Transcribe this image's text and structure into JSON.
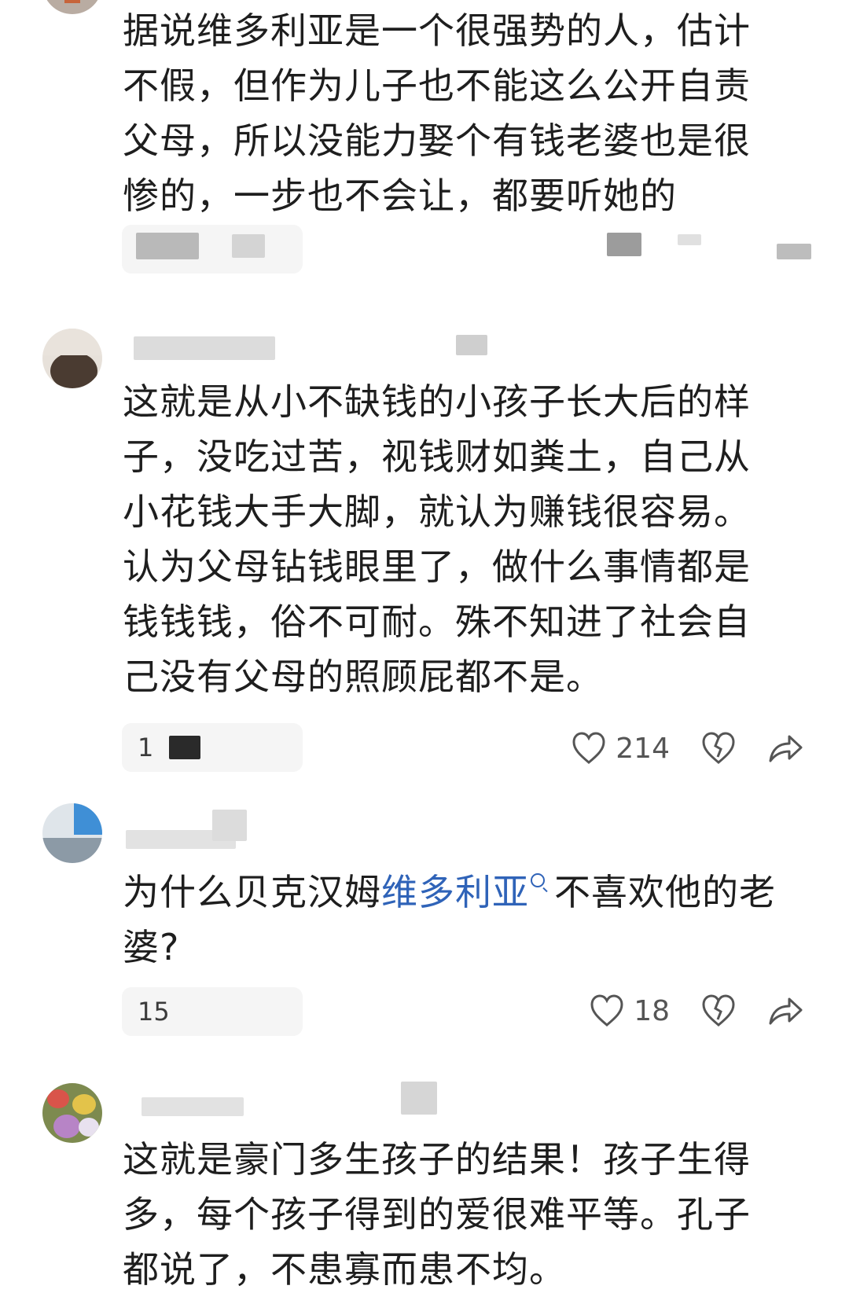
{
  "comments": [
    {
      "text": "据说维多利亚是一个很强势的人，估计不假，但作为儿子也不能这么公开自责父母，所以没能力娶个有钱老婆也是很惨的，一步也不会让，都要听她的"
    },
    {
      "text": "这就是从小不缺钱的小孩子长大后的样子，没吃过苦，视钱财如粪土，自己从小花钱大手大脚，就认为赚钱很容易。认为父母钻钱眼里了，做什么事情都是钱钱钱，俗不可耐。殊不知进了社会自己没有父母的照顾屁都不是。",
      "reply_prefix": "1",
      "likes": "214"
    },
    {
      "text_before": "为什么贝克汉姆",
      "link": "维多利亚",
      "text_after": "不喜欢他的老婆?",
      "reply_prefix": "15",
      "likes": "18"
    },
    {
      "text": "这就是豪门多生孩子的结果！孩子生得多，每个孩子得到的爱很难平等。孔子都说了，不患寡而患不均。"
    }
  ],
  "icons": {
    "like": "heart-outline-icon",
    "dislike": "broken-heart-icon",
    "share": "share-arrow-icon"
  },
  "colors": {
    "text": "#1e1e1e",
    "link": "#2f63b8",
    "meta": "#a8a8a8",
    "pill": "#f5f5f5"
  }
}
